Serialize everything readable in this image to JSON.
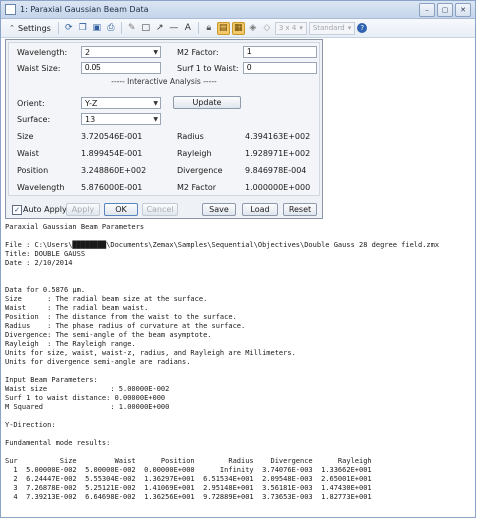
{
  "window": {
    "title": "1: Paraxial Gaussian Beam Data",
    "min_label": "–",
    "max_label": "▢",
    "close_label": "✕"
  },
  "toolbar": {
    "settings_label": "Settings",
    "layout_dropdown": "3 x 4",
    "style_dropdown": "Standard",
    "help_label": "?"
  },
  "settings": {
    "wavelength_label": "Wavelength:",
    "wavelength_value": "2",
    "m2_label": "M2 Factor:",
    "m2_value": "1",
    "waist_label": "Waist Size:",
    "waist_value": "0.05",
    "surf1_label": "Surf 1 to Waist:",
    "surf1_value": "0",
    "section_title": "----- Interactive Analysis -----",
    "orient_label": "Orient:",
    "orient_value": "Y-Z",
    "update_label": "Update",
    "surface_label": "Surface:",
    "surface_value": "13"
  },
  "results": {
    "size_label": "Size",
    "size_value": "3.720546E-001",
    "radius_label": "Radius",
    "radius_value": "4.394163E+002",
    "waist_label": "Waist",
    "waist_value": "1.899454E-001",
    "rayleigh_label": "Rayleigh",
    "rayleigh_value": "1.928971E+002",
    "position_label": "Position",
    "position_value": "3.248860E+002",
    "divergence_label": "Divergence",
    "divergence_value": "9.846978E-004",
    "wavelength_label": "Wavelength",
    "wavelength_value": "5.876000E-001",
    "m2_label": "M2 Factor",
    "m2_value": "1.000000E+000"
  },
  "buttons": {
    "auto_apply_label": "Auto Apply",
    "apply_label": "Apply",
    "ok_label": "OK",
    "cancel_label": "Cancel",
    "save_label": "Save",
    "load_label": "Load",
    "reset_label": "Reset"
  },
  "report": {
    "lines": [
      "Paraxial Gaussian Beam Parameters",
      "",
      "File : C:\\Users\\████████\\Documents\\Zemax\\Samples\\Sequential\\Objectives\\Double Gauss 28 degree field.zmx",
      "Title: DOUBLE GAUSS",
      "Date : 2/10/2014",
      "",
      "",
      "Data for 0.5876 µm.",
      "Size      : The radial beam size at the surface.",
      "Waist     : The radial beam waist.",
      "Position  : The distance from the waist to the surface.",
      "Radius    : The phase radius of curvature at the surface.",
      "Divergence: The semi-angle of the beam asymptote.",
      "Rayleigh  : The Rayleigh range.",
      "Units for size, waist, waist-z, radius, and Rayleigh are Millimeters.",
      "Units for divergence semi-angle are radians.",
      "",
      "Input Beam Parameters:",
      "Waist size               : 5.00000E-002",
      "Surf 1 to waist distance: 0.00000E+000",
      "M Squared                : 1.00000E+000",
      "",
      "Y-Direction:",
      "",
      "Fundamental mode results:",
      "",
      "Sur          Size         Waist      Position        Radius    Divergence      Rayleigh",
      "  1  5.00000E-002  5.00000E-002  0.00000E+000      Infinity  3.74076E-003  1.33662E+001",
      "  2  6.24447E-002  5.55304E-002  1.36297E+001  6.51534E+001  2.09548E-003  2.65001E+001",
      "  3  7.26878E-002  5.25121E-002  1.41069E+001  2.95148E+001  3.56181E-003  1.47430E+001",
      "  4  7.39213E-002  6.64698E-002  1.36256E+001  9.72889E+001  3.73653E-003  1.82773E+001"
    ]
  }
}
